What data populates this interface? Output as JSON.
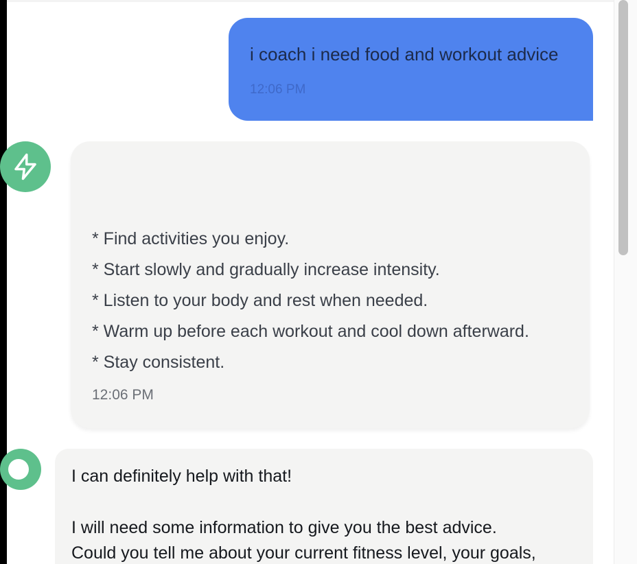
{
  "colors": {
    "user_bubble": "#4f83ee",
    "bot_bubble": "#f4f4f3",
    "avatar": "#5ec08c",
    "scroll_thumb": "#c1c1c1"
  },
  "messages": {
    "user": {
      "text": "i coach i need food and workout advice",
      "time": "12:06 PM"
    },
    "bot1": {
      "avatar_icon": "lightning-icon",
      "bullets": [
        "* Find activities you enjoy.",
        "* Start slowly and gradually increase intensity.",
        "* Listen to your body and rest when needed.",
        "* Warm up before each workout and cool down afterward.",
        "* Stay consistent."
      ],
      "time": "12:06 PM"
    },
    "bot2": {
      "avatar_icon": "circle-icon",
      "lines": [
        "I can definitely help with that!",
        "I will need some information to give you the best advice.",
        "Could you tell me about your current fitness level, your goals,"
      ]
    }
  }
}
